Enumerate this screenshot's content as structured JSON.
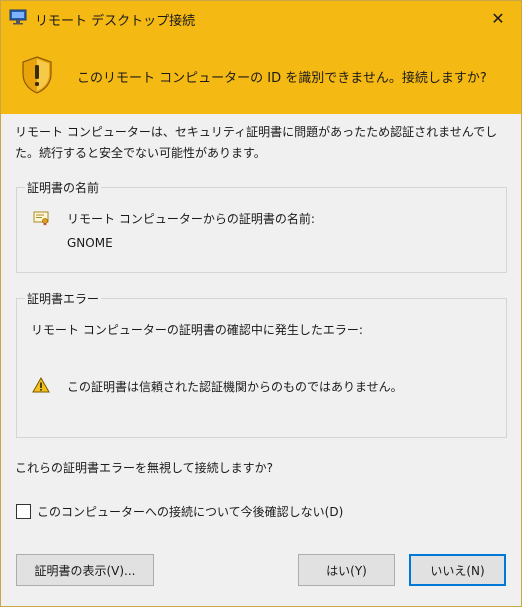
{
  "window": {
    "title": "リモート デスクトップ接続",
    "close_glyph": "✕"
  },
  "banner": {
    "message": "このリモート コンピューターの ID を識別できません。接続しますか?"
  },
  "intro": {
    "line1": "リモート コンピューターは、セキュリティ証明書に問題があったため認証されませんでし",
    "line2": "た。続行すると安全でない可能性があります。"
  },
  "cert_name_group": {
    "title": "証明書の名前",
    "label": "リモート コンピューターからの証明書の名前:",
    "value": "GNOME"
  },
  "cert_error_group": {
    "title": "証明書エラー",
    "intro": "リモート コンピューターの証明書の確認中に発生したエラー:",
    "message": "この証明書は信頼された認証機関からのものではありません。"
  },
  "question": "これらの証明書エラーを無視して接続しますか?",
  "checkbox": {
    "label": "このコンピューターへの接続について今後確認しない(D)",
    "checked": false
  },
  "buttons": {
    "view_cert": "証明書の表示(V)...",
    "yes": "はい(Y)",
    "no": "いいえ(N)"
  },
  "colors": {
    "banner_bg": "#f5b913",
    "dialog_bg": "#f0f0f0",
    "default_button_border": "#0078d7"
  }
}
